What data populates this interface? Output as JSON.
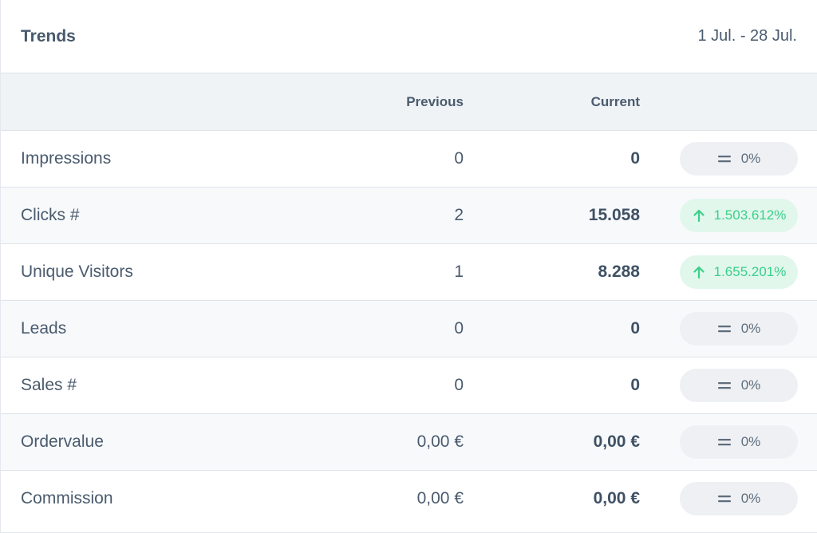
{
  "header": {
    "title": "Trends",
    "date_range": "1 Jul. - 28 Jul."
  },
  "columns": {
    "label": "",
    "previous": "Previous",
    "current": "Current"
  },
  "colors": {
    "neutral_badge_bg": "#eef0f3",
    "neutral_badge_text": "#5e6d7d",
    "up_badge_bg": "#e1f7ec",
    "up_badge_text": "#3ccf8a"
  },
  "rows": [
    {
      "label": "Impressions",
      "previous": "0",
      "current": "0",
      "change": "0%",
      "trend": "equal",
      "icon": "equals-icon"
    },
    {
      "label": "Clicks #",
      "previous": "2",
      "current": "15.058",
      "change": "1.503.612%",
      "trend": "up",
      "icon": "arrow-up-icon"
    },
    {
      "label": "Unique Visitors",
      "previous": "1",
      "current": "8.288",
      "change": "1.655.201%",
      "trend": "up",
      "icon": "arrow-up-icon"
    },
    {
      "label": "Leads",
      "previous": "0",
      "current": "0",
      "change": "0%",
      "trend": "equal",
      "icon": "equals-icon"
    },
    {
      "label": "Sales #",
      "previous": "0",
      "current": "0",
      "change": "0%",
      "trend": "equal",
      "icon": "equals-icon"
    },
    {
      "label": "Ordervalue",
      "previous": "0,00 €",
      "current": "0,00 €",
      "change": "0%",
      "trend": "equal",
      "icon": "equals-icon"
    },
    {
      "label": "Commission",
      "previous": "0,00 €",
      "current": "0,00 €",
      "change": "0%",
      "trend": "equal",
      "icon": "equals-icon"
    }
  ]
}
